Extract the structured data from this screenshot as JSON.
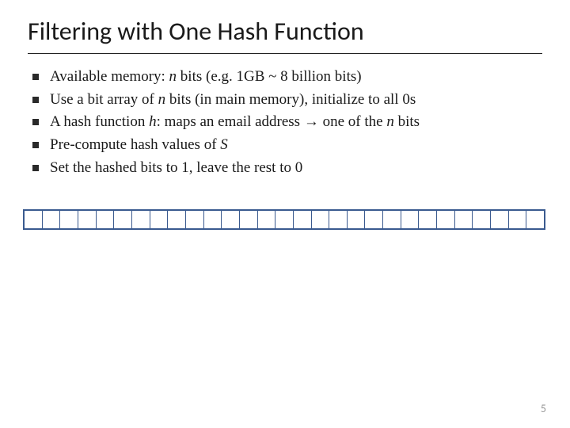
{
  "slide": {
    "title": "Filtering with One Hash Function",
    "bullets": [
      {
        "pre": "Available memory: ",
        "it1": "n",
        "mid1": " bits (e.g. 1GB ~ 8 billion bits)",
        "it2": "",
        "mid2": "",
        "it3": "",
        "tail": ""
      },
      {
        "pre": "Use a bit array of ",
        "it1": "n",
        "mid1": " bits (in main memory), initialize to all 0s",
        "it2": "",
        "mid2": "",
        "it3": "",
        "tail": ""
      },
      {
        "pre": "A hash function ",
        "it1": "h",
        "mid1": ": maps an email address → one of the ",
        "it2": "n",
        "mid2": " bits",
        "it3": "",
        "tail": ""
      },
      {
        "pre": "Pre-compute hash values of ",
        "it1": "S",
        "mid1": "",
        "it2": "",
        "mid2": "",
        "it3": "",
        "tail": ""
      },
      {
        "pre": "Set the hashed bits to 1, leave the rest to 0",
        "it1": "",
        "mid1": "",
        "it2": "",
        "mid2": "",
        "it3": "",
        "tail": ""
      }
    ],
    "bit_array_cells": 29,
    "page_number": "5"
  }
}
